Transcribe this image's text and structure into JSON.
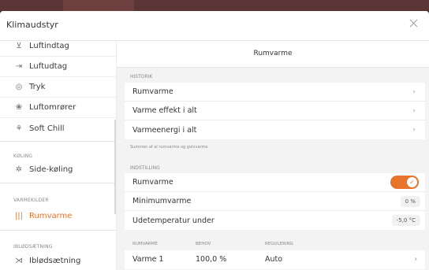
{
  "dialog": {
    "title": "Klimaudstyr"
  },
  "sidebar": {
    "items_top": [
      {
        "icon": "air-intake-icon",
        "glyph": "⊻",
        "label": "Luftindtag"
      },
      {
        "icon": "air-outlet-icon",
        "glyph": "⇥",
        "label": "Luftudtag"
      },
      {
        "icon": "pressure-icon",
        "glyph": "◎",
        "label": "Tryk"
      },
      {
        "icon": "air-stirrer-icon",
        "glyph": "❀",
        "label": "Luftomrører"
      },
      {
        "icon": "soft-chill-icon",
        "glyph": "⚘",
        "label": "Soft Chill"
      }
    ],
    "cooling_header": "KØLING",
    "cooling_item": {
      "glyph": "✲",
      "label": "Side-køling"
    },
    "heating_header": "VARMEKILDER",
    "heating_item": {
      "glyph": "|||",
      "label": "Rumvarme"
    },
    "humid_header": "IBLØDSÆTNING",
    "humid_item": {
      "glyph": "⋊",
      "label": "Iblødsætning"
    }
  },
  "main": {
    "title": "Rumvarme",
    "history_label": "HISTORIK",
    "history_rows": [
      "Rumvarme",
      "Varme effekt i alt",
      "Varmeenergi i alt"
    ],
    "history_note": "Summen af al rumvarme og gulvvarme",
    "settings_label": "INDSTILLING",
    "settings": {
      "rumvarme_label": "Rumvarme",
      "min_label": "Minimumvarme",
      "min_value": "0 %",
      "outdoor_label": "Udetemperatur under",
      "outdoor_value": "-5,0 °C"
    },
    "table": {
      "headers": [
        "RUMVARME",
        "BEHOV",
        "REGULERING"
      ],
      "rows": [
        [
          "Varme 1",
          "100,0 %",
          "Auto"
        ]
      ]
    }
  },
  "colors": {
    "accent": "#e8732b"
  }
}
